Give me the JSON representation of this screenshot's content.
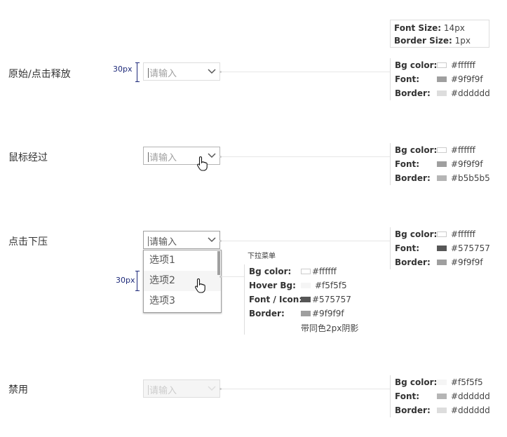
{
  "size_box": {
    "font_size_label": "Font Size:",
    "font_size_value": "14px",
    "border_size_label": "Border Size:",
    "border_size_value": "1px"
  },
  "dim_label": "30px",
  "placeholder": "请输入",
  "rows": [
    {
      "label": "原始/点击释放",
      "spec": [
        {
          "key": "Bg color:",
          "value": "#ffffff",
          "color": "#ffffff"
        },
        {
          "key": "Font:",
          "value": "#9f9f9f",
          "color": "#9f9f9f"
        },
        {
          "key": "Border:",
          "value": "#dddddd",
          "color": "#dddddd"
        }
      ]
    },
    {
      "label": "鼠标经过",
      "spec": [
        {
          "key": "Bg color:",
          "value": "#ffffff",
          "color": "#ffffff"
        },
        {
          "key": "Font:",
          "value": "#9f9f9f",
          "color": "#9f9f9f"
        },
        {
          "key": "Border:",
          "value": "#b5b5b5",
          "color": "#b5b5b5"
        }
      ]
    },
    {
      "label": "点击下压",
      "spec": [
        {
          "key": "Bg color:",
          "value": "#ffffff",
          "color": "#ffffff"
        },
        {
          "key": "Font:",
          "value": "#575757",
          "color": "#575757"
        },
        {
          "key": "Border:",
          "value": "#9f9f9f",
          "color": "#9f9f9f"
        }
      ]
    },
    {
      "label": "禁用",
      "spec": [
        {
          "key": "Bg color:",
          "value": "#f5f5f5",
          "color": "#f5f5f5"
        },
        {
          "key": "Font:",
          "value": "#dddddd",
          "color": "#dddddd"
        },
        {
          "key": "Border:",
          "value": "#dddddd",
          "color": "#dddddd"
        }
      ]
    }
  ],
  "dropdown": {
    "options": [
      "选项1",
      "选项2",
      "选项3"
    ],
    "title": "下拉菜单",
    "spec": [
      {
        "key": "Bg color:",
        "value": "#ffffff",
        "color": "#ffffff"
      },
      {
        "key": "Hover Bg:",
        "value": "#f5f5f5",
        "color": "#f5f5f5"
      },
      {
        "key": "Font / Icon:",
        "value": "#575757",
        "color": "#575757"
      },
      {
        "key": "Border:",
        "value": "#9f9f9f",
        "color": "#9f9f9f"
      }
    ],
    "note": "带同色2px阴影"
  }
}
